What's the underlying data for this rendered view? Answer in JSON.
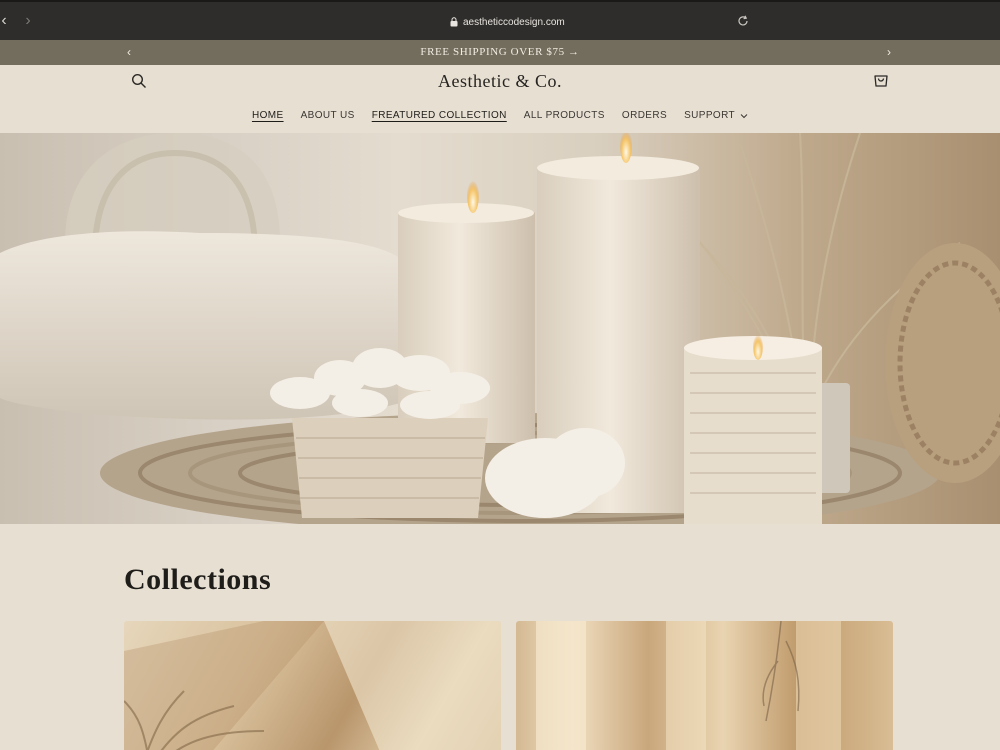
{
  "browser": {
    "url": "aestheticcodesign.com"
  },
  "announcement": {
    "text": "FREE SHIPPING OVER $75 →"
  },
  "header": {
    "brand": "Aesthetic & Co."
  },
  "nav": [
    {
      "label": "HOME",
      "active": true
    },
    {
      "label": "ABOUT US",
      "active": false
    },
    {
      "label": "FREATURED COLLECTION",
      "active": true
    },
    {
      "label": "ALL PRODUCTS",
      "active": false
    },
    {
      "label": "ORDERS",
      "active": false
    },
    {
      "label": "SUPPORT",
      "active": false
    }
  ],
  "collections": {
    "title": "Collections"
  },
  "colors": {
    "announcement_bg": "#726d5d",
    "page_bg": "#e7dfd2",
    "chrome_bg": "#2f2d2b"
  }
}
